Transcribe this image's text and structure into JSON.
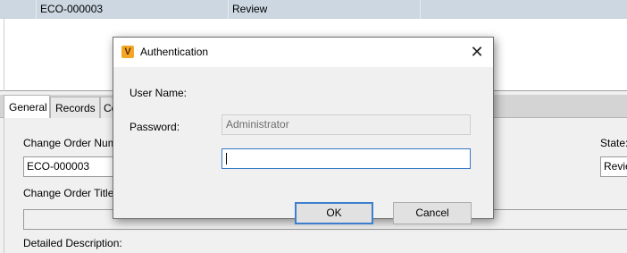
{
  "grid": {
    "row": {
      "number": "ECO-000003",
      "state": "Review"
    }
  },
  "tabs": [
    "General",
    "Records",
    "Co"
  ],
  "general": {
    "change_order_number_label": "Change Order Num",
    "change_order_number_value": "ECO-000003",
    "state_label": "State:",
    "state_value": "Revie",
    "change_order_title_label": "Change Order Title",
    "change_order_title_value": "",
    "detailed_description_label": "Detailed Description:"
  },
  "dialog": {
    "logo_letter": "V",
    "title": "Authentication",
    "close_glyph": "✕",
    "username_label": "User Name:",
    "username_value": "Administrator",
    "password_label": "Password:",
    "password_value": "",
    "ok_label": "OK",
    "cancel_label": "Cancel"
  },
  "colors": {
    "selected_row": "#ccd7e1",
    "logo": "#f5a623",
    "focus_border": "#3478c8",
    "default_button_border": "#3c7fcf"
  }
}
